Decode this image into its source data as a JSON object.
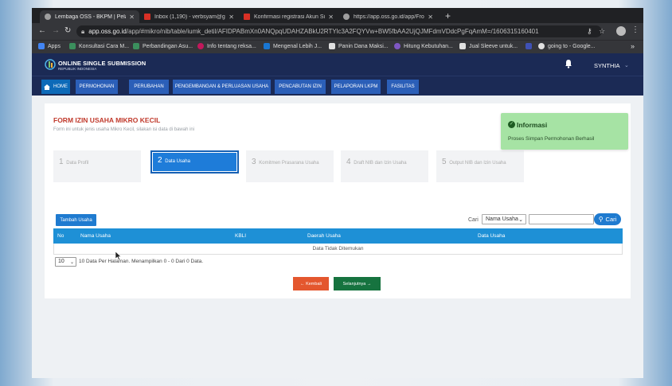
{
  "browser": {
    "tabs": [
      {
        "label": "Lembaga OSS - BKPM | Pelaya",
        "favicon_color": "#9e9e9e",
        "active": true
      },
      {
        "label": "Inbox (1,190) - verbsyam@gm",
        "favicon_color": "#d93025",
        "active": false
      },
      {
        "label": "Konfirmasi registrasi Akun Sist",
        "favicon_color": "#d93025",
        "active": false
      },
      {
        "label": "https://app.oss.go.id/app/Fron",
        "favicon_color": "#9e9e9e",
        "active": false
      }
    ],
    "new_tab": "+",
    "url_host": "app.oss.go.id",
    "url_rest": "/app/#mikro/nib/table/iumk_detil/AFIDPABmXn0ANQpqUDAHZABkU2RTYlc3A2FQYVw+BW5fbAA2UjQJMFdmVDdcPgFqAmM=/1606315160401",
    "bookmarks": [
      {
        "label": "Apps",
        "color": "#4285f4"
      },
      {
        "label": "Konsultasi Cara M...",
        "color": "#3b8f5d"
      },
      {
        "label": "Perbandingan Asu...",
        "color": "#3b8f5d"
      },
      {
        "label": "Info tentang reksa...",
        "color": "#c2185b"
      },
      {
        "label": "Mengenal Lebih J...",
        "color": "#1976d2"
      },
      {
        "label": "Panin Dana Maksi...",
        "color": "#e0e0e0"
      },
      {
        "label": "Hitung Kebutuhan...",
        "color": "#7e57c2"
      },
      {
        "label": "Jual Sleeve untuk...",
        "color": "#e0e0e0"
      },
      {
        "label": "",
        "color": "#3f51b5"
      },
      {
        "label": "going to - Google...",
        "color": "#e0e0e0"
      }
    ],
    "bookmarks_more": "»"
  },
  "site": {
    "logo_title": "ONLINE SINGLE SUBMISSION",
    "logo_subtitle": "REPUBLIK INDONESIA",
    "user_name": "SYNTHIA",
    "user_caret": "⌄",
    "nav": [
      {
        "label": "HOME"
      },
      {
        "label": "PERMOHONAN"
      },
      {
        "label": "PERUBAHAN"
      },
      {
        "label": "PENGEMBANGAN & PERLUASAN USAHA"
      },
      {
        "label": "PENCABUTAN IZIN"
      },
      {
        "label": "PELAPORAN LKPM"
      },
      {
        "label": "FASILITAS"
      }
    ]
  },
  "form": {
    "title": "FORM IZIN USAHA MIKRO KECIL",
    "subtitle": "Form ini untuk jenis usaha Mikro Kecil, silakan isi data di bawah ini",
    "steps": [
      {
        "num": "1",
        "label": "Data Profil",
        "active": false
      },
      {
        "num": "2",
        "label": "Data Usaha",
        "active": true
      },
      {
        "num": "3",
        "label": "Komitmen Prasarana Usaha",
        "active": false
      },
      {
        "num": "4",
        "label": "Draft NIB dan Izin Usaha",
        "active": false
      },
      {
        "num": "5",
        "label": "Output NIB dan Izin Usaha",
        "active": false
      }
    ],
    "add_button": "Tambah Usaha",
    "search_label": "Cari",
    "search_field_selected": "Nama Usaha",
    "search_placeholder": "",
    "search_button": "Cari",
    "table": {
      "columns": [
        "No",
        "Nama Usaha",
        "KBLI",
        "Daerah Usaha",
        "Data Usaha"
      ],
      "empty_text": "Data Tidak Ditemukan"
    },
    "per_page_value": "10",
    "per_page_text": "10 Data Per Halaman. Menampilkan 0 - 0 Dari 0 Data.",
    "back_button": "← Kembali",
    "next_button": "Selanjutnya →"
  },
  "toast": {
    "title": "Informasi",
    "message": "Proses Simpan Permohonan Berhasil"
  }
}
